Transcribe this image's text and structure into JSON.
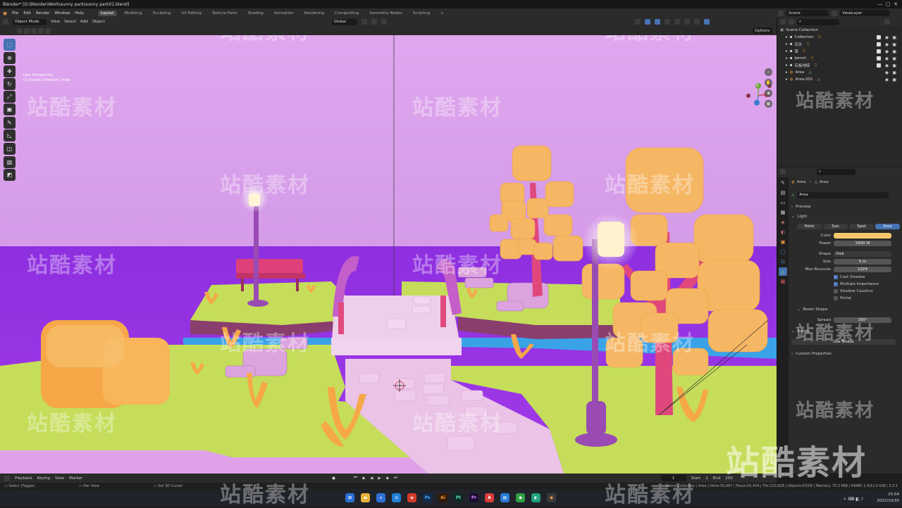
{
  "titlebar": {
    "title": "Blender* [D:\\Blender\\Work\\sunny park\\sunny park01.blend]"
  },
  "menu": {
    "items": [
      "File",
      "Edit",
      "Render",
      "Window",
      "Help"
    ],
    "workspaces": [
      "Layout",
      "Modeling",
      "Sculpting",
      "UV Editing",
      "Texture Paint",
      "Shading",
      "Animation",
      "Rendering",
      "Compositing",
      "Geometry Nodes",
      "Scripting"
    ],
    "active_workspace": "Layout",
    "add_tab": "+"
  },
  "topright": {
    "scene": "Scene",
    "view_layer": "ViewLayer"
  },
  "viewport_header": {
    "mode": "Object Mode",
    "menus": [
      "View",
      "Select",
      "Add",
      "Object"
    ],
    "transform": "Global",
    "options": "Options"
  },
  "viewport": {
    "perspective": "User Perspective",
    "collection_line": "(1) Scene Collection | Area"
  },
  "gizmo": {
    "z": "Z",
    "y": "Y",
    "x": "X"
  },
  "outliner": {
    "root": "Scene Collection",
    "items": [
      {
        "name": "Collection"
      },
      {
        "name": "石头"
      },
      {
        "name": "草"
      },
      {
        "name": "bench"
      },
      {
        "name": "石板地砖"
      },
      {
        "name": "Area"
      },
      {
        "name": "Area.001"
      }
    ]
  },
  "properties": {
    "breadcrumb": [
      "Area",
      "Area"
    ],
    "data_name": "Area",
    "sections": {
      "preview": "Preview",
      "light": "Light",
      "nodes": "Nodes",
      "custom_properties": "Custom Properties",
      "beam_shape": "Beam Shape"
    },
    "light_types": [
      "Point",
      "Sun",
      "Spot",
      "Area"
    ],
    "active_light_type": "Area",
    "color_label": "Color",
    "color_value": "#f4c76a",
    "power_label": "Power",
    "power_value": "1000 W",
    "shape_label": "Shape",
    "shape_value": "Disk",
    "size_label": "Size",
    "size_value": "5 m",
    "max_bounces_label": "Max Bounces",
    "max_bounces_value": "1024",
    "checks": [
      {
        "label": "Cast Shadow",
        "checked": true
      },
      {
        "label": "Multiple Importance",
        "checked": true
      },
      {
        "label": "Shadow Caustics",
        "checked": false
      },
      {
        "label": "Portal",
        "checked": false
      }
    ],
    "spread_label": "Spread",
    "spread_value": "180°",
    "use_nodes": "Use Nodes"
  },
  "timeline": {
    "menus": [
      "Playback",
      "Keying",
      "View",
      "Marker"
    ],
    "current_frame": "1",
    "start_label": "Start",
    "start_value": "1",
    "end_label": "End",
    "end_value": "250"
  },
  "statusbar": {
    "left": [
      "Select (Toggle)",
      "Pan View",
      "Set 3D Cursor"
    ],
    "stats": "Scene Collection | Area | Verts:55,667 | Faces:55,434 | Tris:110,628 | Objects:0/109 | Memory: 70.3 MiB | VRAM: 1.4/12.0 GiB | 3.3.1"
  },
  "taskbar": {
    "time": "15:54",
    "date": "2022/10/30",
    "app_labels": [
      "Ps",
      "Ai",
      "Pt",
      "Pr"
    ]
  },
  "watermark": "站酷素材",
  "colors": {
    "accent": "#4772b3",
    "sky": "#d9a0ec",
    "floor": "#9a36e6",
    "grass": "#c5dd5a",
    "path": "#eac3e6",
    "foliage": "#f6b764",
    "trunk": "#e0487d",
    "lamp": "#9a4bb3"
  }
}
